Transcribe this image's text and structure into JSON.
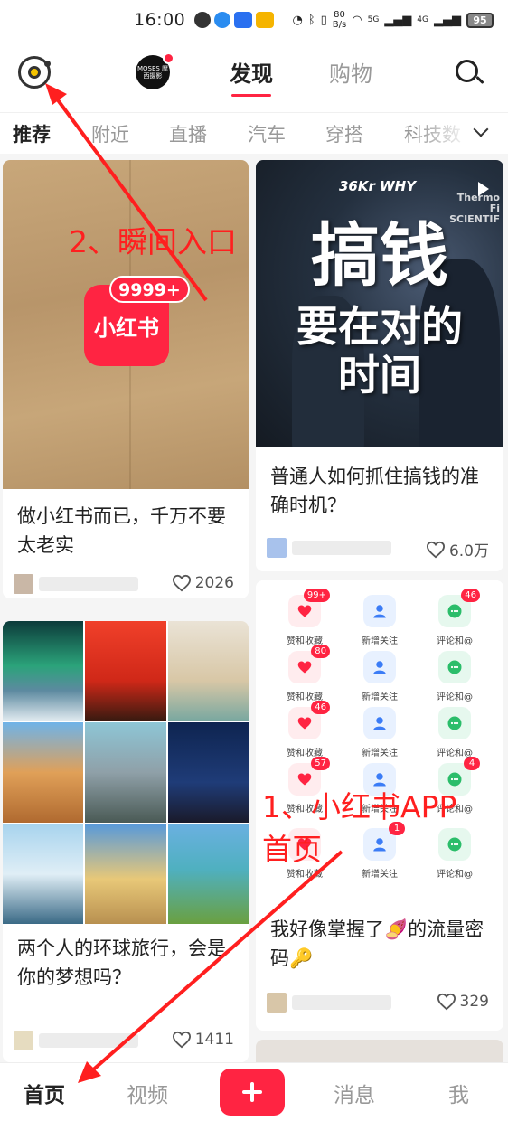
{
  "status_bar": {
    "time": "16:00",
    "speed_value": "80",
    "speed_unit": "B/s",
    "net1": "5G",
    "net2": "4G",
    "battery": "95"
  },
  "top_nav": {
    "brand_label": "MOSES 摩西摄影",
    "tabs": [
      {
        "label": "发现",
        "active": true
      },
      {
        "label": "购物",
        "active": false
      }
    ]
  },
  "categories": [
    {
      "label": "推荐",
      "active": true
    },
    {
      "label": "附近"
    },
    {
      "label": "直播"
    },
    {
      "label": "汽车"
    },
    {
      "label": "穿搭"
    },
    {
      "label": "科技数"
    }
  ],
  "feed": {
    "cards": [
      {
        "title": "做小红书而已，千万不要太老实",
        "likes": "2026",
        "app_name": "小红书",
        "badge": "9999+"
      },
      {
        "title": "普通人如何抓住搞钱的准确时机？",
        "likes": "6.0万",
        "thumb_line1": "搞钱",
        "thumb_line2": "要在对的",
        "thumb_line3": "时间",
        "thumb_brand": "36Kr WHY",
        "thumb_corner": "Thermo Fi SCIENTIF"
      },
      {
        "title": "两个人的环球旅行，会是你的梦想吗？",
        "likes": "1411"
      },
      {
        "title": "我好像掌握了🍠的流量密码🔑",
        "likes": "329",
        "notifications": [
          [
            {
              "label": "赞和收藏",
              "badge": "99+",
              "icon": "heart-icon"
            },
            {
              "label": "新增关注",
              "badge": "",
              "icon": "person-icon"
            },
            {
              "label": "评论和@",
              "badge": "46",
              "icon": "chat-icon"
            }
          ],
          [
            {
              "label": "赞和收藏",
              "badge": "80",
              "icon": "heart-icon"
            },
            {
              "label": "新增关注",
              "badge": "",
              "icon": "person-icon"
            },
            {
              "label": "评论和@",
              "badge": "",
              "icon": "chat-icon"
            }
          ],
          [
            {
              "label": "赞和收藏",
              "badge": "46",
              "icon": "heart-icon"
            },
            {
              "label": "新增关注",
              "badge": "",
              "icon": "person-icon"
            },
            {
              "label": "评论和@",
              "badge": "",
              "icon": "chat-icon"
            }
          ],
          [
            {
              "label": "赞和收藏",
              "badge": "57",
              "icon": "heart-icon"
            },
            {
              "label": "新增关注",
              "badge": "",
              "icon": "person-icon"
            },
            {
              "label": "评论和@",
              "badge": "4",
              "icon": "chat-icon"
            }
          ],
          [
            {
              "label": "赞和收藏",
              "badge": "",
              "icon": "heart-icon"
            },
            {
              "label": "新增关注",
              "badge": "1",
              "icon": "person-icon"
            },
            {
              "label": "评论和@",
              "badge": "",
              "icon": "chat-icon"
            }
          ]
        ]
      }
    ]
  },
  "bottom_tabs": [
    {
      "label": "首页",
      "active": true
    },
    {
      "label": "视频"
    },
    {
      "label": "消息"
    },
    {
      "label": "我"
    }
  ],
  "annotations": {
    "label1": "1、小红书APP",
    "label1b": "首页",
    "label2": "2、瞬间入口"
  },
  "colors": {
    "brand_red": "#ff2442",
    "annotation_red": "#ff1f1f"
  }
}
